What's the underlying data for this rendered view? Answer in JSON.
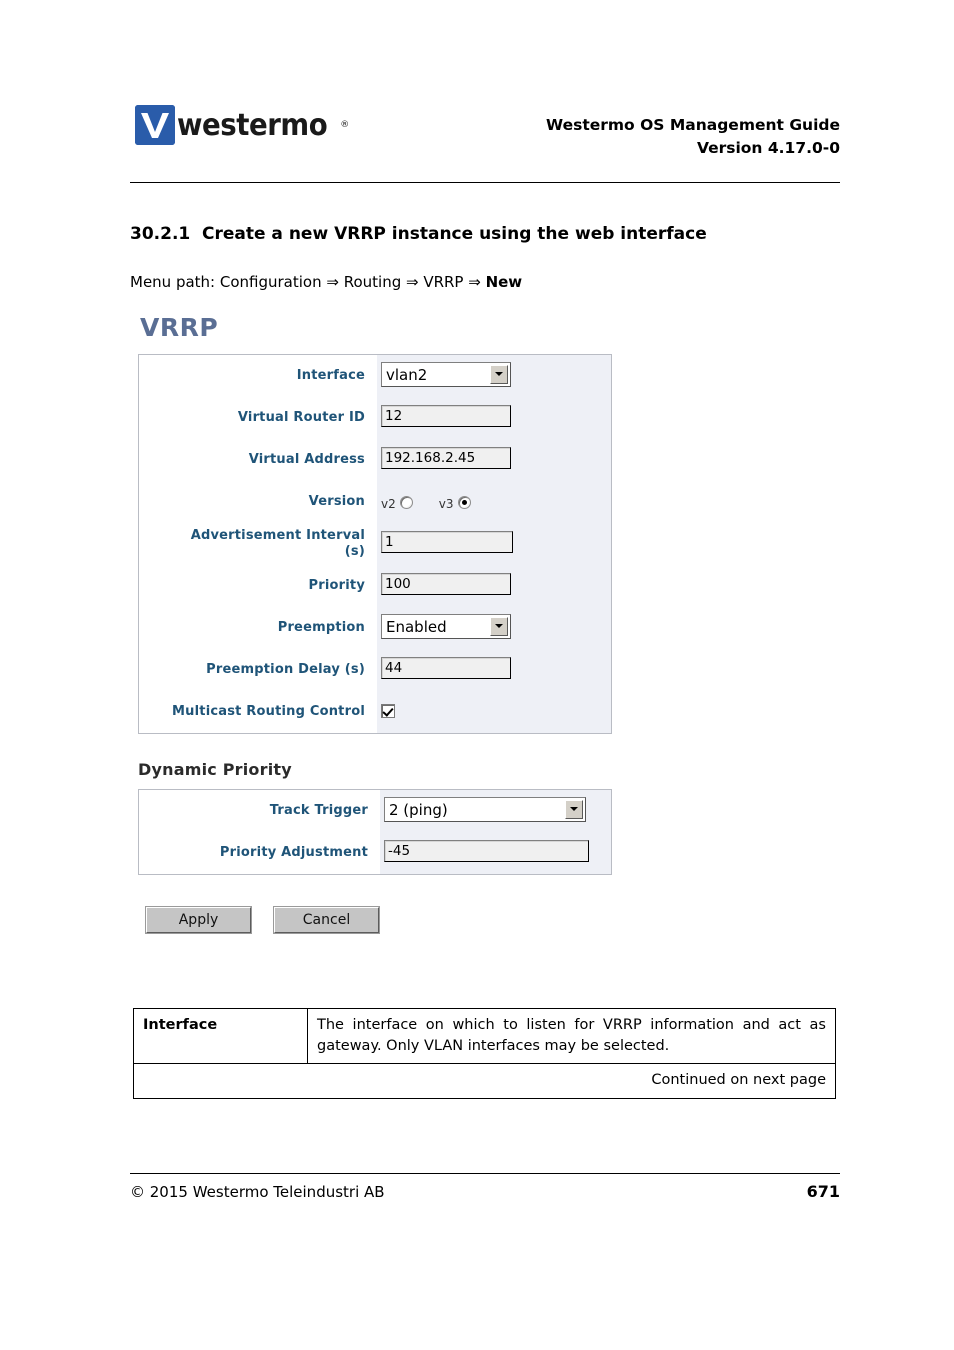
{
  "header": {
    "logo_word": "westermo",
    "logo_reg": "®",
    "title": "Westermo OS Management Guide",
    "version": "Version 4.17.0-0"
  },
  "section": {
    "number": "30.2.1",
    "title": "Create a new VRRP instance using the web interface",
    "menu_path_prefix": "Menu path: Configuration ⇒ Routing ⇒ VRRP ⇒ ",
    "menu_path_last": "New"
  },
  "webui": {
    "title": "VRRP",
    "fields": {
      "interface": {
        "label": "Interface",
        "type": "select",
        "value": "vlan2"
      },
      "virtual_router_id": {
        "label": "Virtual Router ID",
        "type": "text",
        "value": "12"
      },
      "virtual_address": {
        "label": "Virtual Address",
        "type": "text",
        "value": "192.168.2.45"
      },
      "version": {
        "label": "Version",
        "type": "radio",
        "option1": "v2",
        "option2": "v3",
        "selected": "v3"
      },
      "advertisement_interval": {
        "label_line1": "Advertisement Interval",
        "label_line2": "(s)",
        "type": "text",
        "value": "1"
      },
      "priority": {
        "label": "Priority",
        "type": "text",
        "value": "100"
      },
      "preemption": {
        "label": "Preemption",
        "type": "select",
        "value": "Enabled"
      },
      "preemption_delay": {
        "label": "Preemption Delay (s)",
        "type": "text",
        "value": "44"
      },
      "multicast_routing_control": {
        "label": "Multicast Routing Control",
        "type": "checkbox",
        "checked": true
      }
    },
    "dynamic_priority": {
      "heading": "Dynamic Priority",
      "track_trigger": {
        "label": "Track Trigger",
        "type": "select",
        "value": "2 (ping)"
      },
      "priority_adjustment": {
        "label": "Priority Adjustment",
        "type": "text",
        "value": "-45"
      }
    },
    "buttons": {
      "apply": "Apply",
      "cancel": "Cancel"
    }
  },
  "description_table": {
    "rows": [
      {
        "term": "Interface",
        "definition": "The interface on which to listen for VRRP information and act as gateway. Only VLAN interfaces may be selected."
      }
    ],
    "continued": "Continued on next page"
  },
  "footer": {
    "copyright": "© 2015 Westermo Teleindustri AB",
    "page_number": "671"
  },
  "colors": {
    "logo_blue": "#2a5caa",
    "vrrp_title": "#5a6e94",
    "form_label": "#1f5478",
    "panel_tint": "#eef0f6"
  }
}
